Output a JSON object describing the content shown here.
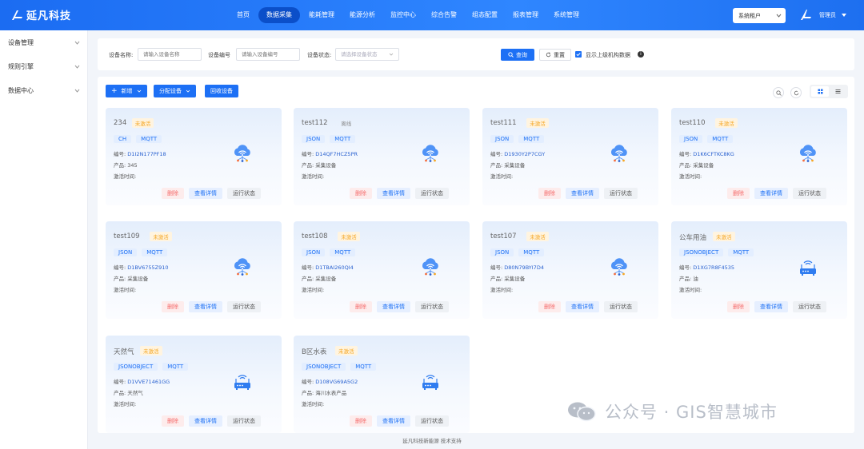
{
  "header": {
    "brand": "延凡科技",
    "nav": [
      "首页",
      "数据采集",
      "能耗管理",
      "能源分析",
      "监控中心",
      "综合告警",
      "组态配置",
      "报表管理",
      "系统管理"
    ],
    "active_nav": 1,
    "tenant": "系统租户",
    "user": "管理员"
  },
  "sidebar": {
    "items": [
      {
        "label": "设备管理"
      },
      {
        "label": "规则引擎"
      },
      {
        "label": "数据中心"
      }
    ]
  },
  "search": {
    "name_label": "设备名称:",
    "name_placeholder": "请输入设备名称",
    "code_label": "设备编号",
    "code_placeholder": "请输入设备编号",
    "state_label": "设备状态:",
    "state_placeholder": "请选择设备状态",
    "query": "查询",
    "reset": "重置",
    "show_parent": "显示上级机构数据"
  },
  "toolbar": {
    "add": "新增",
    "assign": "分配设备",
    "recycle": "回收设备"
  },
  "labels": {
    "code": "编号:",
    "product": "产品:",
    "activated": "激活时间:",
    "delete": "删除",
    "detail": "查看详情",
    "run_status": "运行状态"
  },
  "devices": [
    {
      "name": "234",
      "status": "未激活",
      "status_type": "inactive",
      "tags": [
        "CH",
        "MQTT"
      ],
      "code": "D1I2N177PF18",
      "product": "345",
      "icon": "cloud-wifi-icon"
    },
    {
      "name": "test112",
      "status": "离线",
      "status_type": "offline",
      "tags": [
        "JSON",
        "MQTT"
      ],
      "code": "D14QF7HCZ5PR",
      "product": "采集设备",
      "icon": "cloud-wifi-icon"
    },
    {
      "name": "test111",
      "status": "未激活",
      "status_type": "inactive",
      "tags": [
        "JSON",
        "MQTT"
      ],
      "code": "D1930Y2P7CGY",
      "product": "采集设备",
      "icon": "cloud-wifi-icon"
    },
    {
      "name": "test110",
      "status": "未激活",
      "status_type": "inactive",
      "tags": [
        "JSON",
        "MQTT"
      ],
      "code": "D1K6CFTKC8KG",
      "product": "采集设备",
      "icon": "cloud-wifi-icon"
    },
    {
      "name": "test109",
      "status": "未激活",
      "status_type": "inactive",
      "tags": [
        "JSON",
        "MQTT"
      ],
      "code": "D1BV6755Z910",
      "product": "采集设备",
      "icon": "cloud-wifi-icon"
    },
    {
      "name": "test108",
      "status": "未激活",
      "status_type": "inactive",
      "tags": [
        "JSON",
        "MQTT"
      ],
      "code": "D1TBAI260QI4",
      "product": "采集设备",
      "icon": "cloud-wifi-icon"
    },
    {
      "name": "test107",
      "status": "未激活",
      "status_type": "inactive",
      "tags": [
        "JSON",
        "MQTT"
      ],
      "code": "D80N79BYI7D4",
      "product": "采集设备",
      "icon": "cloud-wifi-icon"
    },
    {
      "name": "公车用油",
      "status": "未激活",
      "status_type": "inactive",
      "tags": [
        "JSONOBJECT",
        "MQTT"
      ],
      "code": "D1XG7R8F4535",
      "product": "油",
      "icon": "router-icon"
    },
    {
      "name": "天然气",
      "status": "未激活",
      "status_type": "inactive",
      "tags": [
        "JSONOBJECT",
        "MQTT"
      ],
      "code": "D1VVE71461GG",
      "product": "天然气",
      "icon": "router-icon"
    },
    {
      "name": "B区水表",
      "status": "未激活",
      "status_type": "inactive",
      "tags": [
        "JSONOBJECT",
        "MQTT"
      ],
      "code": "D108VG69A5G2",
      "product": "海川水表产品",
      "icon": "router-icon"
    }
  ],
  "footer": "延凡科技新能源 技术支持",
  "watermark": "公众号 · GIS智慧城市"
}
